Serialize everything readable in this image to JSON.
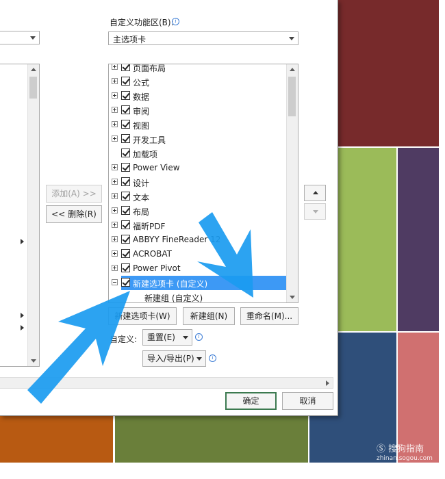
{
  "background_colors": [
    "#772a2b",
    "#9bbb59",
    "#4f3b62",
    "#2f4f7a",
    "#d07070",
    "#b85a12",
    "#6a7f3a"
  ],
  "customize_ribbon": {
    "label": "自定义功能区(B):",
    "dropdown_value": "主选项卡",
    "tree_items": [
      {
        "label": "页面布局",
        "expander": "plus",
        "checked": true
      },
      {
        "label": "公式",
        "expander": "plus",
        "checked": true
      },
      {
        "label": "数据",
        "expander": "plus",
        "checked": true
      },
      {
        "label": "审阅",
        "expander": "plus",
        "checked": true
      },
      {
        "label": "视图",
        "expander": "plus",
        "checked": true
      },
      {
        "label": "开发工具",
        "expander": "plus",
        "checked": true
      },
      {
        "label": "加载项",
        "expander": "none",
        "checked": true
      },
      {
        "label": "Power View",
        "expander": "plus",
        "checked": true
      },
      {
        "label": "设计",
        "expander": "plus",
        "checked": true
      },
      {
        "label": "文本",
        "expander": "plus",
        "checked": true
      },
      {
        "label": "布局",
        "expander": "plus",
        "checked": true
      },
      {
        "label": "福昕PDF",
        "expander": "plus",
        "checked": true
      },
      {
        "label": "ABBYY FineReader 12",
        "expander": "plus",
        "checked": true
      },
      {
        "label": "ACROBAT",
        "expander": "plus",
        "checked": true
      },
      {
        "label": "Power Pivot",
        "expander": "plus",
        "checked": true
      },
      {
        "label": "新建选项卡 (自定义)",
        "expander": "minus",
        "checked": true,
        "selected": true
      }
    ],
    "sub_item": "新建组 (自定义)"
  },
  "buttons": {
    "add": "添加(A) >>",
    "remove": "<< 删除(R)",
    "new_tab": "新建选项卡(W)",
    "new_group": "新建组(N)",
    "rename": "重命名(M)...",
    "reset_label": "自定义:",
    "reset": "重置(E)",
    "import_export": "导入/导出(P)",
    "ok": "确定",
    "cancel": "取消"
  },
  "arrow_color": "#1a9bf0",
  "watermark": {
    "title": "搜狗指南",
    "url": "zhinan.sogou.com"
  }
}
